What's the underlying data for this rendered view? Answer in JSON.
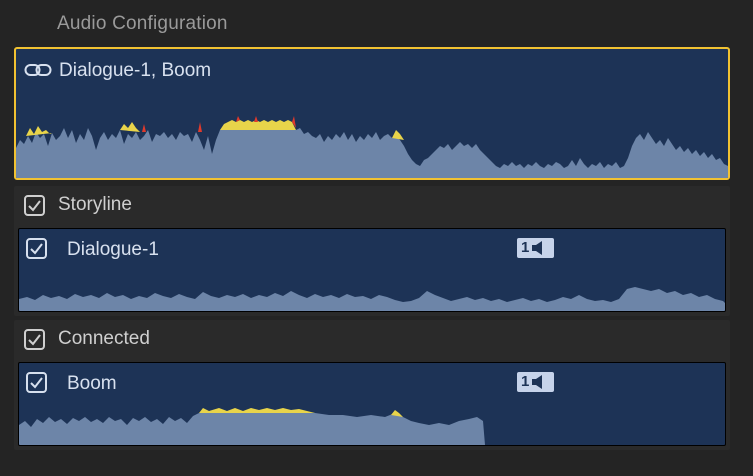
{
  "panel": {
    "title": "Audio Configuration"
  },
  "main_clip": {
    "label": "Dialogue-1, Boom",
    "link_icon": "link-icon"
  },
  "storyline": {
    "label": "Storyline",
    "checked": true,
    "clip": {
      "label": "Dialogue-1",
      "checked": true,
      "channel": "1",
      "channel_icon": "speaker-icon"
    }
  },
  "connected": {
    "label": "Connected",
    "checked": true,
    "clip": {
      "label": "Boom",
      "checked": true,
      "channel": "1",
      "channel_icon": "speaker-icon"
    }
  },
  "colors": {
    "clip_bg": "#1d3356",
    "waveform": "#6d85a8",
    "selection": "#f1c232",
    "peak_yellow": "#e8d44a",
    "peak_red": "#e03a2c"
  }
}
